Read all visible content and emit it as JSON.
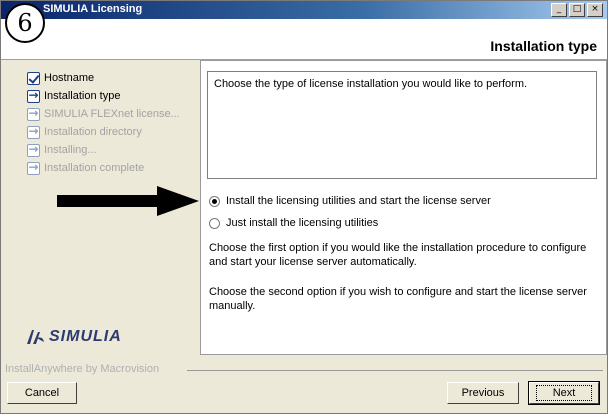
{
  "window": {
    "title": "SIMULIA Licensing",
    "minimize_label": "_",
    "maximize_label": "□",
    "close_label": "×"
  },
  "step_badge": "6",
  "header": {
    "heading": "Installation type"
  },
  "sidebar": {
    "items": [
      {
        "label": "Hostname",
        "state": "done",
        "icon": "checkbox-check-icon"
      },
      {
        "label": "Installation type",
        "state": "current",
        "icon": "arrow-right-icon"
      },
      {
        "label": "SIMULIA FLEXnet license...",
        "state": "pending",
        "icon": "arrow-right-icon"
      },
      {
        "label": "Installation directory",
        "state": "pending",
        "icon": "arrow-right-icon"
      },
      {
        "label": "Installing...",
        "state": "pending",
        "icon": "arrow-right-icon"
      },
      {
        "label": "Installation complete",
        "state": "pending",
        "icon": "arrow-right-icon"
      }
    ],
    "logo_text": "SIMULIA"
  },
  "main": {
    "description": "Choose the type of license installation you would like to perform.",
    "options": [
      {
        "label": "Install the licensing utilities and start the license server",
        "selected": true
      },
      {
        "label": "Just install the licensing utilities",
        "selected": false
      }
    ],
    "help1": "Choose the first option if you would like the installation procedure to configure and start your license server automatically.",
    "help2": "Choose the second option if you wish to configure and start the license server manually."
  },
  "footer": {
    "vendor": "InstallAnywhere by Macrovision",
    "cancel_label": "Cancel",
    "previous_label": "Previous",
    "next_label": "Next"
  },
  "colors": {
    "title_bar": "#0a246a",
    "accent": "#1d3f8a",
    "dim_text": "#a3a3a3"
  }
}
